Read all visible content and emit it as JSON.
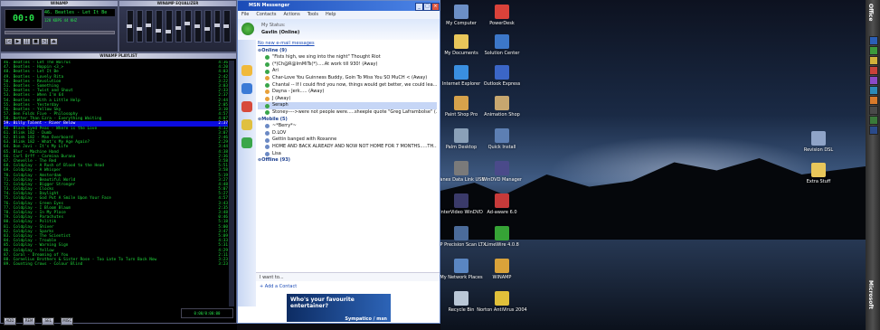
{
  "winamp": {
    "main_title": "WINAMP",
    "eq_title": "WINAMP EQUALIZER",
    "time": "00:0",
    "song": "46. Beatles - Let It Be",
    "kbps": "128 KBPS 44 KHZ",
    "buttons": [
      "|<",
      "▶",
      "||",
      "■",
      ">|",
      "⏏"
    ],
    "eq_levels": [
      0.5,
      0.4,
      0.55,
      0.35,
      0.3,
      0.45,
      0.6,
      0.5,
      0.4,
      0.55,
      0.5
    ],
    "playlist_title": "WINAMP PLAYLIST",
    "playlist": [
      {
        "t": "46. Beatles - Let The Walrus",
        "d": "4:36"
      },
      {
        "t": "47. Beatles - Hoppin <3_>",
        "d": "4:20"
      },
      {
        "t": "48. Beatles - Let It Be",
        "d": "4:03"
      },
      {
        "t": "49. Beatles - Lovely Rita",
        "d": "2:42"
      },
      {
        "t": "50. Beatles - Revolution",
        "d": "3:22"
      },
      {
        "t": "51. Beatles - Something",
        "d": "3:03"
      },
      {
        "t": "52. Beatles - Twist and Shout",
        "d": "2:33"
      },
      {
        "t": "53. Beatles - When I'm 64",
        "d": "2:37"
      },
      {
        "t": "54. Beatles - With a Little Help",
        "d": "2:44"
      },
      {
        "t": "55. Beatles - Yesterday",
        "d": "2:05"
      },
      {
        "t": "56. Beatles - Yellow Sky",
        "d": "3:10"
      },
      {
        "t": "57. Ben Folds Five - Philosophy",
        "d": "4:57"
      },
      {
        "t": "58. Better Than Ezra - Everything Waiting",
        "d": "4:07"
      },
      {
        "t": "59. Billy Talent - River Below",
        "d": "2:37"
      },
      {
        "t": "60. Black Eyed Peas - Where is the Love",
        "d": "4:32"
      },
      {
        "t": "61. Blink 182 - Dumb",
        "d": "3:07"
      },
      {
        "t": "62. Blink 182 - Man Overboard",
        "d": "2:46"
      },
      {
        "t": "63. Blink 182 - What's My Age Again?",
        "d": "2:29"
      },
      {
        "t": "64. Bon Jovi - It's My Life",
        "d": "3:44"
      },
      {
        "t": "65. Blur - Machine Hand",
        "d": "4:38"
      },
      {
        "t": "66. Carl Orff - Carmina Burana",
        "d": "2:36"
      },
      {
        "t": "67. Chevelle - The Red",
        "d": "3:58"
      },
      {
        "t": "68. Coldplay - A Rush of Blood to the Head",
        "d": "5:51"
      },
      {
        "t": "69. Coldplay - A Whisper",
        "d": "3:58"
      },
      {
        "t": "70. Coldplay - Amsterdam",
        "d": "5:19"
      },
      {
        "t": "71. Coldplay - Beautiful World",
        "d": "3:27"
      },
      {
        "t": "72. Coldplay - Bigger Stronger",
        "d": "4:48"
      },
      {
        "t": "73. Coldplay - Clocks",
        "d": "5:07"
      },
      {
        "t": "74. Coldplay - Daylight",
        "d": "5:27"
      },
      {
        "t": "75. Coldplay - God Put A Smile Upon Your Face",
        "d": "4:57"
      },
      {
        "t": "76. Coldplay - Green Eyes",
        "d": "3:43"
      },
      {
        "t": "77. Coldplay - I Bloom Blaum",
        "d": "2:35"
      },
      {
        "t": "78. Coldplay - In My Place",
        "d": "3:48"
      },
      {
        "t": "79. Coldplay - Parachutes",
        "d": "0:46"
      },
      {
        "t": "80. Coldplay - Politik",
        "d": "5:18"
      },
      {
        "t": "81. Coldplay - Shiver",
        "d": "5:00"
      },
      {
        "t": "82. Coldplay - Sparks",
        "d": "3:47"
      },
      {
        "t": "83. Coldplay - The Scientist",
        "d": "5:09"
      },
      {
        "t": "84. Coldplay - Trouble",
        "d": "4:33"
      },
      {
        "t": "85. Coldplay - Warning Sign",
        "d": "5:31"
      },
      {
        "t": "86. Coldplay - Yellow",
        "d": "4:29"
      },
      {
        "t": "87. Coral - Dreaming of You",
        "d": "2:11"
      },
      {
        "t": "88. Cornelius Brothers & Sister Rose - Too Late To Turn Back Now",
        "d": "3:23"
      },
      {
        "t": "89. Counting Crows - Colour Blind",
        "d": "3:23"
      }
    ],
    "selected_index": 13,
    "bottom_buttons": [
      "ADD",
      "REM",
      "SEL",
      "MISC"
    ],
    "pl_time": "0:00/0:00:00"
  },
  "msn": {
    "title": "MSN Messenger",
    "menu": [
      "File",
      "Contacts",
      "Actions",
      "Tools",
      "Help"
    ],
    "status_label": "My Status:",
    "user": "Gavlin (Online)",
    "email_link": "No new e-mail messages",
    "groups": [
      {
        "name": "Online (9)",
        "contacts": [
          "\"Fists high, we sing into the night\" Thought Riot",
          "(*)Ch@R@ImMiTs(*).....At work till 930! (Away)",
          "Ari",
          "Char-Love You Guinness Buddy, Goin To Miss You SO MuCH < (Away)",
          "Chantal -- If I could find you now, things would get better, we could lea...",
          "Dayna - Jerk..... (Away)",
          "J (Away)",
          "Seraph",
          "Stoney---->were not people were.....sheeple quote \"Greg Laframbolse\" (..."
        ]
      },
      {
        "name": "Mobile (5)",
        "contacts": [
          "~*Berry*~",
          "D.LOV",
          "Gettin banged with Roxanne",
          "HOME AND BACK ALREADY AND NOW NOT HOME FOR 7 MONTHS.....TH...",
          "Lisa"
        ]
      },
      {
        "name": "Offline (93)",
        "contacts": []
      }
    ],
    "selected_contact": "Seraph",
    "i_want_to": "I want to...",
    "add_contact": "Add a Contact",
    "ad_text": "Who's your favourite entertainer?",
    "ad_brand": "Sympatico / msn"
  },
  "desktop": {
    "icons": [
      {
        "label": "My Computer",
        "color": "#6c8fc6"
      },
      {
        "label": "PowerDesk",
        "color": "#d9423a"
      },
      {
        "label": "My Documents",
        "color": "#e8c65a"
      },
      {
        "label": "Solution Center",
        "color": "#3c77c9"
      },
      {
        "label": "Internet Explorer",
        "color": "#3a8fe0"
      },
      {
        "label": "Outlook Express",
        "color": "#3b66c7"
      },
      {
        "label": "Paint Shop Pro",
        "color": "#d6a24b"
      },
      {
        "label": "Animation Shop",
        "color": "#c7a76f"
      },
      {
        "label": "Palm Desktop",
        "color": "#8aa0b8"
      },
      {
        "label": "Quick Install",
        "color": "#5d7fb3"
      },
      {
        "label": "Tanex Data Link USB",
        "color": "#7a7a7a"
      },
      {
        "label": "WinDVD Manager",
        "color": "#4a4a8a"
      },
      {
        "label": "InterVideo WinDVD",
        "color": "#3a3a6a"
      },
      {
        "label": "Ad-aware 6.0",
        "color": "#c63a3a"
      },
      {
        "label": "HP Precision Scan LTX",
        "color": "#4b6b9a"
      },
      {
        "label": "LimeWire 4.0.8",
        "color": "#36a336"
      },
      {
        "label": "My Network Places",
        "color": "#5a86c2"
      },
      {
        "label": "WINAMP",
        "color": "#d9a23a"
      },
      {
        "label": "Recycle Bin",
        "color": "#b9c7d6"
      },
      {
        "label": "Norton AntiVirus 2004",
        "color": "#e0c03a"
      },
      {
        "label": "Revision DSL",
        "color": "#8fa4c8"
      },
      {
        "label": "Extra Stuff",
        "color": "#e8c65a"
      }
    ]
  },
  "officebar": {
    "top_label": "Office",
    "bottom_label": "Microsoft",
    "icons": [
      "#2b5fb7",
      "#3c9a3c",
      "#d2b23a",
      "#c9423a",
      "#8a4ac7",
      "#2b8ab7",
      "#d97a2a",
      "#4a4a4a",
      "#3a7a3a",
      "#2a4a8a"
    ]
  }
}
